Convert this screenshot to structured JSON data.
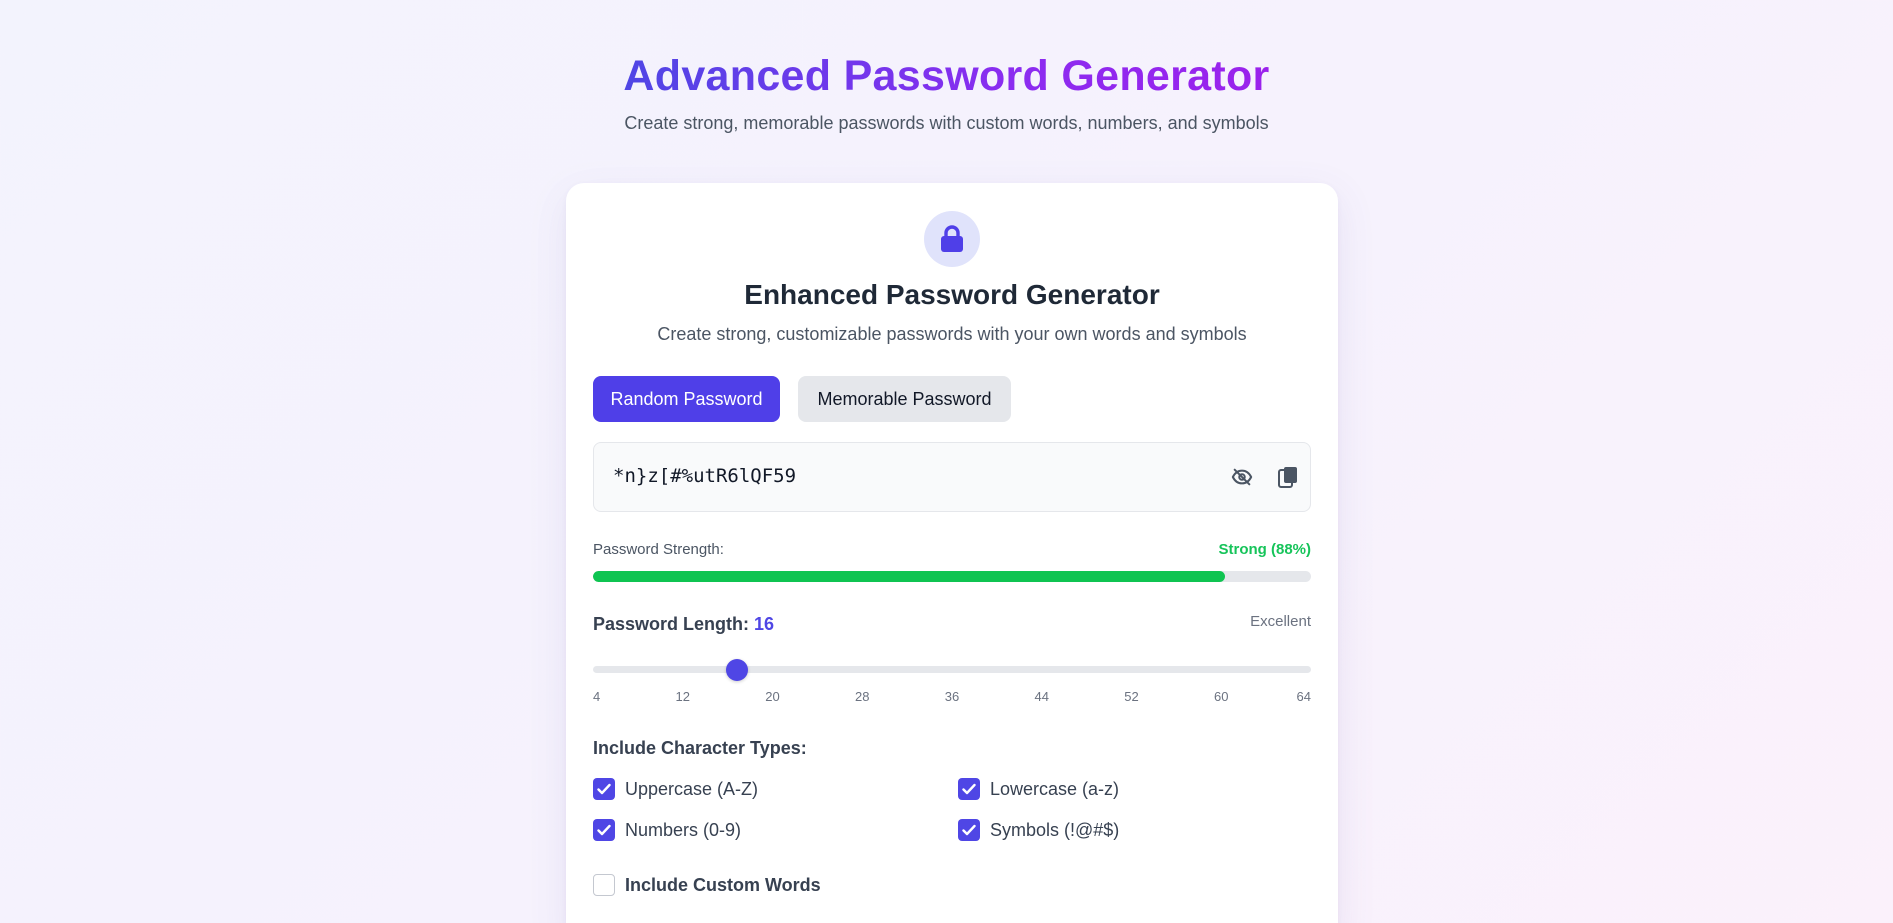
{
  "header": {
    "title": "Advanced Password Generator",
    "subtitle": "Create strong, memorable passwords with custom words, numbers, and symbols"
  },
  "card": {
    "icon": "lock-icon",
    "title": "Enhanced Password Generator",
    "subtitle": "Create strong, customizable passwords with your own words and symbols",
    "tabs": [
      {
        "label": "Random Password",
        "active": true
      },
      {
        "label": "Memorable Password",
        "active": false
      }
    ],
    "password": {
      "value": "*n}z[#%utR6lQF59",
      "visibility_icon": "eye-slash-icon",
      "copy_icon": "copy-icon"
    },
    "strength": {
      "label": "Password Strength:",
      "value_text": "Strong (88%)",
      "percent": 88,
      "color": "#0fc451"
    },
    "length": {
      "label": "Password Length:",
      "value": "16",
      "quality": "Excellent",
      "min": 4,
      "max": 64,
      "ticks": [
        "4",
        "12",
        "20",
        "28",
        "36",
        "44",
        "52",
        "60",
        "64"
      ]
    },
    "character_types": {
      "heading": "Include Character Types:",
      "options": [
        {
          "label": "Uppercase (A-Z)",
          "checked": true
        },
        {
          "label": "Lowercase (a-z)",
          "checked": true
        },
        {
          "label": "Numbers (0-9)",
          "checked": true
        },
        {
          "label": "Symbols (!@#$)",
          "checked": true
        }
      ]
    },
    "custom_words": {
      "label": "Include Custom Words",
      "checked": false
    }
  },
  "colors": {
    "accent": "#4f46e5",
    "title_gradient_start": "#4f46e5",
    "title_gradient_end": "#9b22ec",
    "strength_green": "#16c45a"
  }
}
